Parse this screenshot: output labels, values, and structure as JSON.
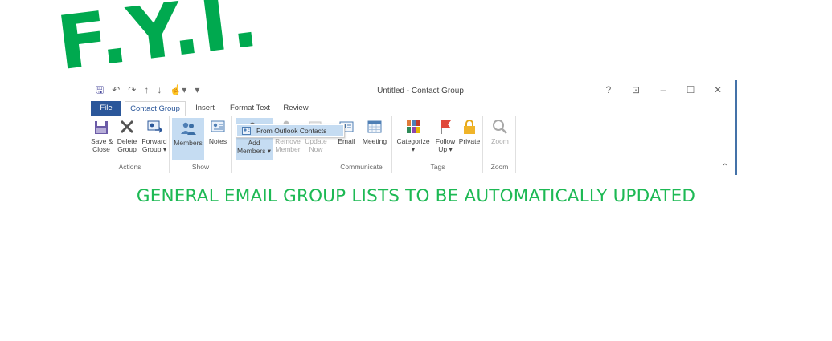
{
  "overlay": {
    "fyi": "F.Y.I.",
    "headline": "GENERAL EMAIL GROUP LISTS TO BE AUTOMATICALLY UPDATED",
    "accent_color": "#00a94f"
  },
  "window": {
    "title": "Untitled - Contact Group",
    "quick_access": [
      "save-icon",
      "undo-icon",
      "redo-icon",
      "up-arrow-icon",
      "down-arrow-icon",
      "touch-mode-icon",
      "customize-icon"
    ],
    "controls": {
      "help": "?",
      "ribbon_options": "⊡",
      "minimize": "–",
      "maximize": "☐",
      "close": "✕"
    }
  },
  "tabs": [
    {
      "label": "File"
    },
    {
      "label": "Contact Group",
      "active": true
    },
    {
      "label": "Insert"
    },
    {
      "label": "Format Text"
    },
    {
      "label": "Review"
    }
  ],
  "groups": {
    "actions": {
      "label": "Actions",
      "save_close": "Save &\nClose",
      "delete_group": "Delete\nGroup",
      "forward_group": "Forward\nGroup ▾"
    },
    "show": {
      "label": "Show",
      "members": "Members",
      "notes": "Notes"
    },
    "members": {
      "add_members": "Add\nMembers ▾",
      "remove_member": "Remove\nMember",
      "update_now": "Update\nNow"
    },
    "communicate": {
      "label": "Communicate",
      "email": "Email",
      "meeting": "Meeting"
    },
    "tags": {
      "label": "Tags",
      "categorize": "Categorize\n▾",
      "follow_up": "Follow\nUp ▾",
      "private": "Private"
    },
    "zoom": {
      "label": "Zoom",
      "zoom": "Zoom"
    }
  },
  "dropdown": {
    "item": "From Outlook Contacts"
  }
}
